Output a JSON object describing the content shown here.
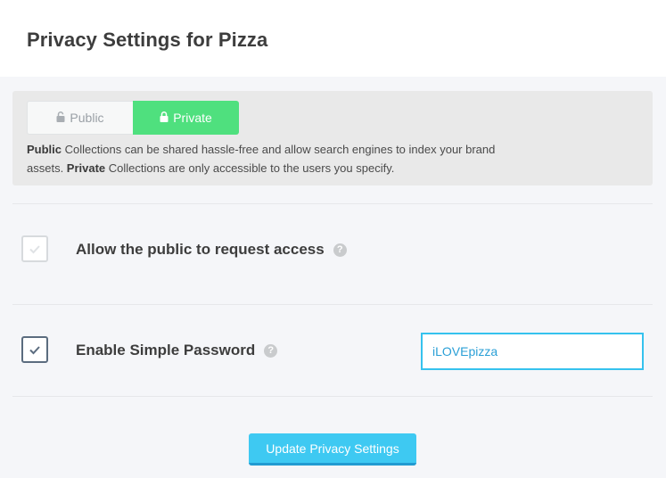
{
  "header": {
    "title": "Privacy Settings for Pizza"
  },
  "privacy_toggle": {
    "public_label": "Public",
    "private_label": "Private",
    "selected": "Private"
  },
  "description": {
    "public_word": "Public",
    "public_text": " Collections can be shared hassle-free and allow search engines to index your brand assets. ",
    "private_word": "Private",
    "private_text": " Collections are only accessible to the users you specify."
  },
  "options": {
    "request_access": {
      "label": "Allow the public to request access",
      "checked": false
    },
    "simple_password": {
      "label": "Enable Simple Password",
      "checked": true,
      "value": "iLOVEpizza"
    }
  },
  "help_icon_glyph": "?",
  "update_button": {
    "label": "Update Privacy Settings"
  },
  "colors": {
    "private_green": "#4fe07e",
    "accent_blue": "#3ec9f2",
    "input_border": "#35c2ee"
  },
  "icons": {
    "lock": "lock-icon",
    "check": "check-icon",
    "help": "help-icon"
  }
}
